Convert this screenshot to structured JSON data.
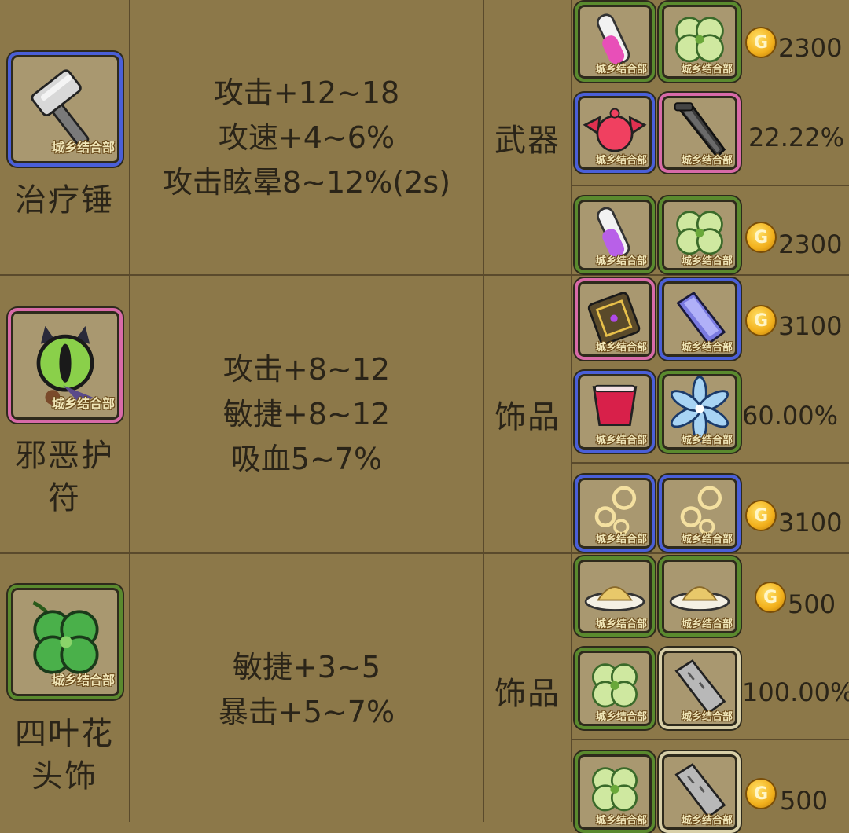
{
  "watermark": "城乡结合部",
  "coin_glyph": "G",
  "rows": [
    {
      "name_lines": [
        "治疗锤"
      ],
      "icon": "hammer-icon",
      "stats": [
        "攻击+12~18",
        "攻速+4~6%",
        "攻击眩晕8~12%(2s)"
      ],
      "slot": "武器",
      "recipe_top": {
        "items": [
          "pink-potion-icon",
          "clover-icon"
        ],
        "cost": "2300"
      },
      "recipe_mid": {
        "items": [
          "red-demon-icon",
          "dark-blade-icon"
        ],
        "rate": "22.22%"
      },
      "recipe_bot": {
        "items": [
          "purple-potion-icon",
          "clover-icon"
        ],
        "cost": "2300"
      }
    },
    {
      "name_lines": [
        "邪恶护",
        "符"
      ],
      "icon": "evil-eye-amulet-icon",
      "stats": [
        "攻击+8~12",
        "敏捷+8~12",
        "吸血5~7%"
      ],
      "slot": "饰品",
      "recipe_top": {
        "items": [
          "magic-book-icon",
          "crystal-bar-icon"
        ],
        "cost": "3100"
      },
      "recipe_mid": {
        "items": [
          "red-goblet-icon",
          "ice-flower-icon"
        ],
        "rate": "60.00%"
      },
      "recipe_bot": {
        "items": [
          "golden-bubbles-icon",
          "golden-bubbles-icon"
        ],
        "cost": "3100"
      }
    },
    {
      "name_lines": [
        "四叶花",
        "头饰"
      ],
      "icon": "four-leaf-clover-icon",
      "stats": [
        "敏捷+3~5",
        "暴击+5~7%"
      ],
      "slot": "饰品",
      "recipe_top": {
        "items": [
          "powder-plate-icon",
          "powder-plate-icon"
        ],
        "cost": "500"
      },
      "recipe_mid": {
        "items": [
          "clover-icon",
          "stone-slab-icon"
        ],
        "rate": "100.00%"
      },
      "recipe_bot": {
        "items": [
          "clover-icon",
          "stone-slab-icon"
        ],
        "cost": "500"
      }
    }
  ]
}
